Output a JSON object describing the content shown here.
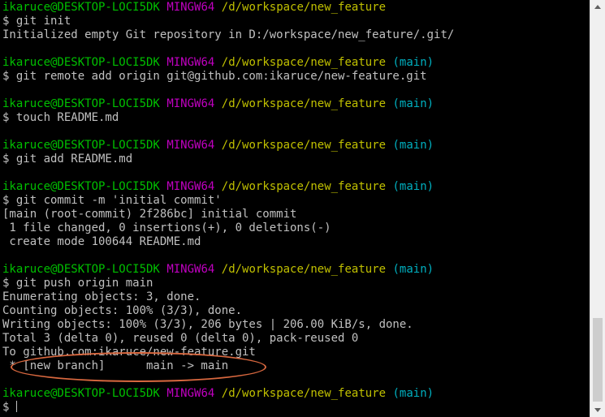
{
  "terminal": {
    "lines": [
      {
        "type": "prompt",
        "user": "ikaruce@DESKTOP-LOCI5DK",
        "env": "MINGW64",
        "path": "/d/workspace/new_feature",
        "branch": ""
      },
      {
        "type": "text",
        "text": "$ git init"
      },
      {
        "type": "text",
        "text": "Initialized empty Git repository in D:/workspace/new_feature/.git/"
      },
      {
        "type": "blank"
      },
      {
        "type": "prompt",
        "user": "ikaruce@DESKTOP-LOCI5DK",
        "env": "MINGW64",
        "path": "/d/workspace/new_feature",
        "branch": "(main)"
      },
      {
        "type": "text",
        "text": "$ git remote add origin git@github.com:ikaruce/new-feature.git"
      },
      {
        "type": "blank"
      },
      {
        "type": "prompt",
        "user": "ikaruce@DESKTOP-LOCI5DK",
        "env": "MINGW64",
        "path": "/d/workspace/new_feature",
        "branch": "(main)"
      },
      {
        "type": "text",
        "text": "$ touch README.md"
      },
      {
        "type": "blank"
      },
      {
        "type": "prompt",
        "user": "ikaruce@DESKTOP-LOCI5DK",
        "env": "MINGW64",
        "path": "/d/workspace/new_feature",
        "branch": "(main)"
      },
      {
        "type": "text",
        "text": "$ git add README.md"
      },
      {
        "type": "blank"
      },
      {
        "type": "prompt",
        "user": "ikaruce@DESKTOP-LOCI5DK",
        "env": "MINGW64",
        "path": "/d/workspace/new_feature",
        "branch": "(main)"
      },
      {
        "type": "text",
        "text": "$ git commit -m 'initial commit'"
      },
      {
        "type": "text",
        "text": "[main (root-commit) 2f286bc] initial commit"
      },
      {
        "type": "text",
        "text": " 1 file changed, 0 insertions(+), 0 deletions(-)"
      },
      {
        "type": "text",
        "text": " create mode 100644 README.md"
      },
      {
        "type": "blank"
      },
      {
        "type": "prompt",
        "user": "ikaruce@DESKTOP-LOCI5DK",
        "env": "MINGW64",
        "path": "/d/workspace/new_feature",
        "branch": "(main)"
      },
      {
        "type": "text",
        "text": "$ git push origin main"
      },
      {
        "type": "text",
        "text": "Enumerating objects: 3, done."
      },
      {
        "type": "text",
        "text": "Counting objects: 100% (3/3), done."
      },
      {
        "type": "text",
        "text": "Writing objects: 100% (3/3), 206 bytes | 206.00 KiB/s, done."
      },
      {
        "type": "text",
        "text": "Total 3 (delta 0), reused 0 (delta 0), pack-reused 0"
      },
      {
        "type": "text",
        "text": "To github.com:ikaruce/new-feature.git"
      },
      {
        "type": "text",
        "text": " * [new branch]      main -> main"
      },
      {
        "type": "blank"
      },
      {
        "type": "prompt",
        "user": "ikaruce@DESKTOP-LOCI5DK",
        "env": "MINGW64",
        "path": "/d/workspace/new_feature",
        "branch": "(main)"
      },
      {
        "type": "input",
        "text": "$ "
      }
    ]
  },
  "colors": {
    "background": "#000000",
    "foreground": "#c0c0c0",
    "user": "#00c000",
    "env": "#c000c0",
    "path": "#c0c000",
    "branch": "#00b0c0",
    "annotation": "#d9683f",
    "scrollbar_track": "#f0f0f0",
    "scrollbar_thumb": "#cdcdcd"
  },
  "icons": {
    "scroll_up": "scroll-up-arrow-icon",
    "scroll_down": "scroll-down-arrow-icon"
  }
}
